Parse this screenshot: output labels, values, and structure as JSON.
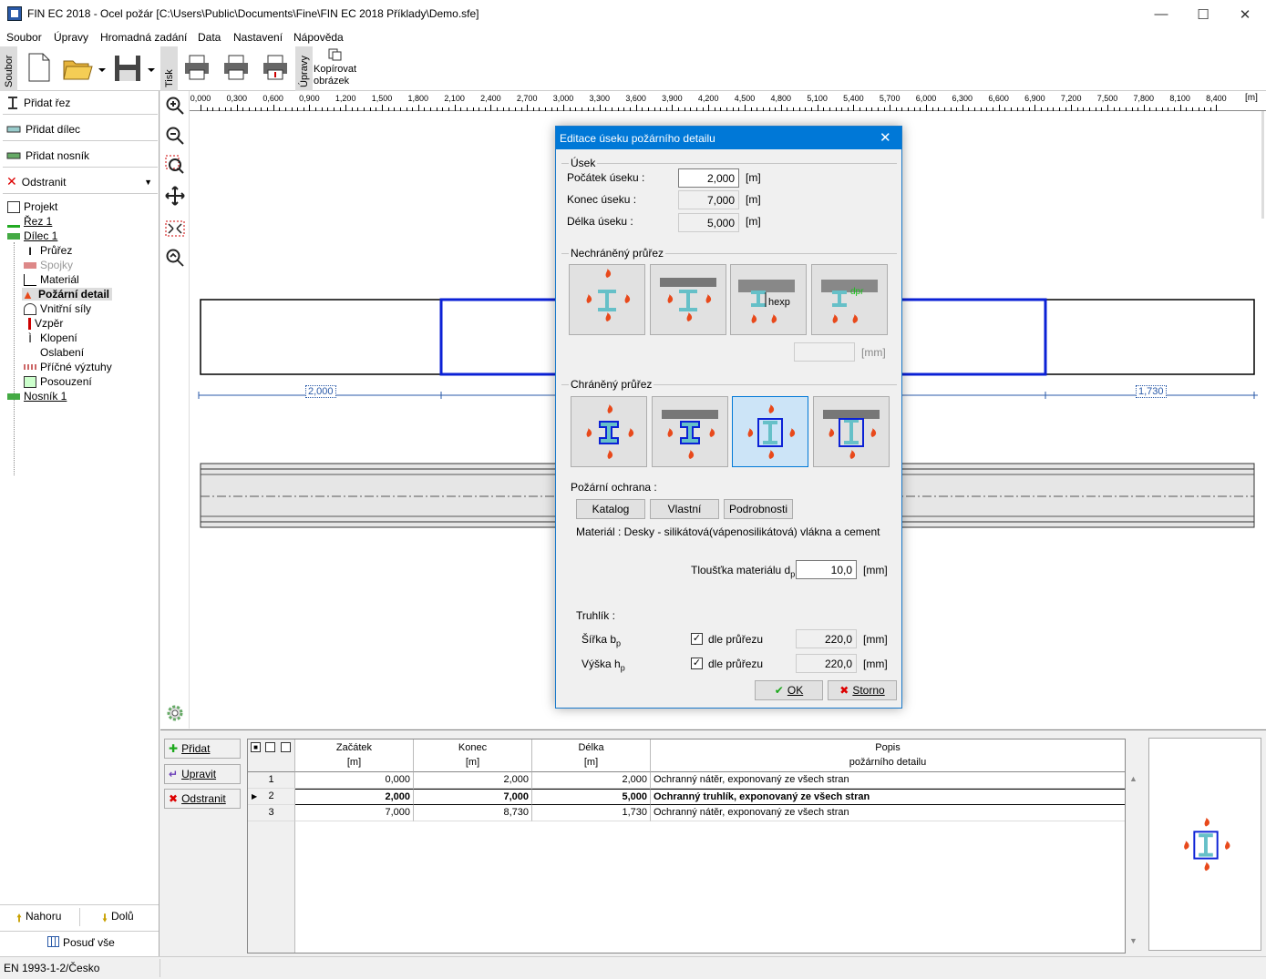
{
  "window": {
    "title": "FIN EC 2018 - Ocel požár [C:\\Users\\Public\\Documents\\Fine\\FIN EC 2018 Příklady\\Demo.sfe]"
  },
  "menu": [
    "Soubor",
    "Úpravy",
    "Hromadná zadání",
    "Data",
    "Nastavení",
    "Nápověda"
  ],
  "toolbar": {
    "tab_file": "Soubor",
    "tab_print": "Tisk",
    "tab_edit": "Úpravy",
    "copy_image": "Kopírovat obrázek"
  },
  "left_actions": [
    "Přidat řez",
    "Přidat dílec",
    "Přidat nosník",
    "Odstranit"
  ],
  "tree": [
    {
      "label": "Projekt",
      "level": 0
    },
    {
      "label": "Řez 1",
      "level": 0
    },
    {
      "label": "Dílec 1",
      "level": 0
    },
    {
      "label": "Průřez",
      "level": 1
    },
    {
      "label": "Spojky",
      "level": 1
    },
    {
      "label": "Materiál",
      "level": 1
    },
    {
      "label": "Požární detail",
      "level": 1
    },
    {
      "label": "Vnitřní síly",
      "level": 1
    },
    {
      "label": "Vzpěr",
      "level": 1
    },
    {
      "label": "Klopení",
      "level": 1
    },
    {
      "label": "Oslabení",
      "level": 1
    },
    {
      "label": "Příčné výztuhy",
      "level": 1
    },
    {
      "label": "Posouzení",
      "level": 1
    },
    {
      "label": "Nosník 1",
      "level": 0
    }
  ],
  "ruler": [
    "0,000",
    "0,300",
    "0,600",
    "0,900",
    "1,200",
    "1,500",
    "1,800",
    "2,100",
    "2,400",
    "2,700",
    "3,000",
    "3,300",
    "3,600",
    "3,900",
    "4,200",
    "4,500",
    "4,800",
    "5,100",
    "5,400",
    "5,700",
    "6,000",
    "6,300",
    "6,600",
    "6,900",
    "7,200",
    "7,500",
    "7,800",
    "8,100",
    "8,400"
  ],
  "ruler_unit": "[m]",
  "dims": {
    "left": "2,000",
    "right": "1,730"
  },
  "dialog": {
    "title": "Editace úseku požárního detailu",
    "group_usek": "Úsek",
    "start_label": "Počátek úseku :",
    "start_value": "2,000",
    "end_label": "Konec úseku :",
    "end_value": "7,000",
    "length_label": "Délka úseku :",
    "length_value": "5,000",
    "unit_m": "[m]",
    "group_unprotected": "Nechráněný průřez",
    "hexp": "hexp",
    "dpr": "dpr",
    "unit_mm": "[mm]",
    "group_protected": "Chráněný průřez",
    "protection_label": "Požární ochrana :",
    "btn_catalog": "Katalog",
    "btn_own": "Vlastní",
    "btn_details": "Podrobnosti",
    "material_text": "Materiál : Desky - silikátová(vápenosilikátová) vlákna a cement",
    "thickness_label": "Tloušťka materiálu d",
    "thickness_sub": "p",
    "thickness_value": "10,0",
    "box_label": "Truhlík :",
    "width_label": "Šířka b",
    "width_sub": "p",
    "width_check": "dle průřezu",
    "width_value": "220,0",
    "height_label": "Výška h",
    "height_sub": "p",
    "height_check": "dle průřezu",
    "height_value": "220,0",
    "ok": "OK",
    "cancel": "Storno"
  },
  "bottom_buttons": [
    "Přidat",
    "Upravit",
    "Odstranit"
  ],
  "table": {
    "headers": [
      {
        "top": "Začátek",
        "unit": "[m]"
      },
      {
        "top": "Konec",
        "unit": "[m]"
      },
      {
        "top": "Délka",
        "unit": "[m]"
      },
      {
        "top": "Popis",
        "unit": "požárního detailu"
      }
    ],
    "rows": [
      {
        "n": "1",
        "start": "0,000",
        "end": "2,000",
        "len": "2,000",
        "desc": "Ochranný nátěr, exponovaný ze všech stran",
        "bold": false
      },
      {
        "n": "2",
        "start": "2,000",
        "end": "7,000",
        "len": "5,000",
        "desc": "Ochranný truhlík, exponovaný ze všech stran",
        "bold": true
      },
      {
        "n": "3",
        "start": "7,000",
        "end": "8,730",
        "len": "1,730",
        "desc": "Ochranný nátěr, exponovaný ze všech stran",
        "bold": false
      }
    ]
  },
  "nav": {
    "up": "Nahoru",
    "down": "Dolů",
    "check_all": "Posuď vše"
  },
  "status": "EN 1993-1-2/Česko",
  "colors": {
    "accent": "#0078d7",
    "beam_blue": "#0b21d6",
    "flame": "#e8491b"
  }
}
